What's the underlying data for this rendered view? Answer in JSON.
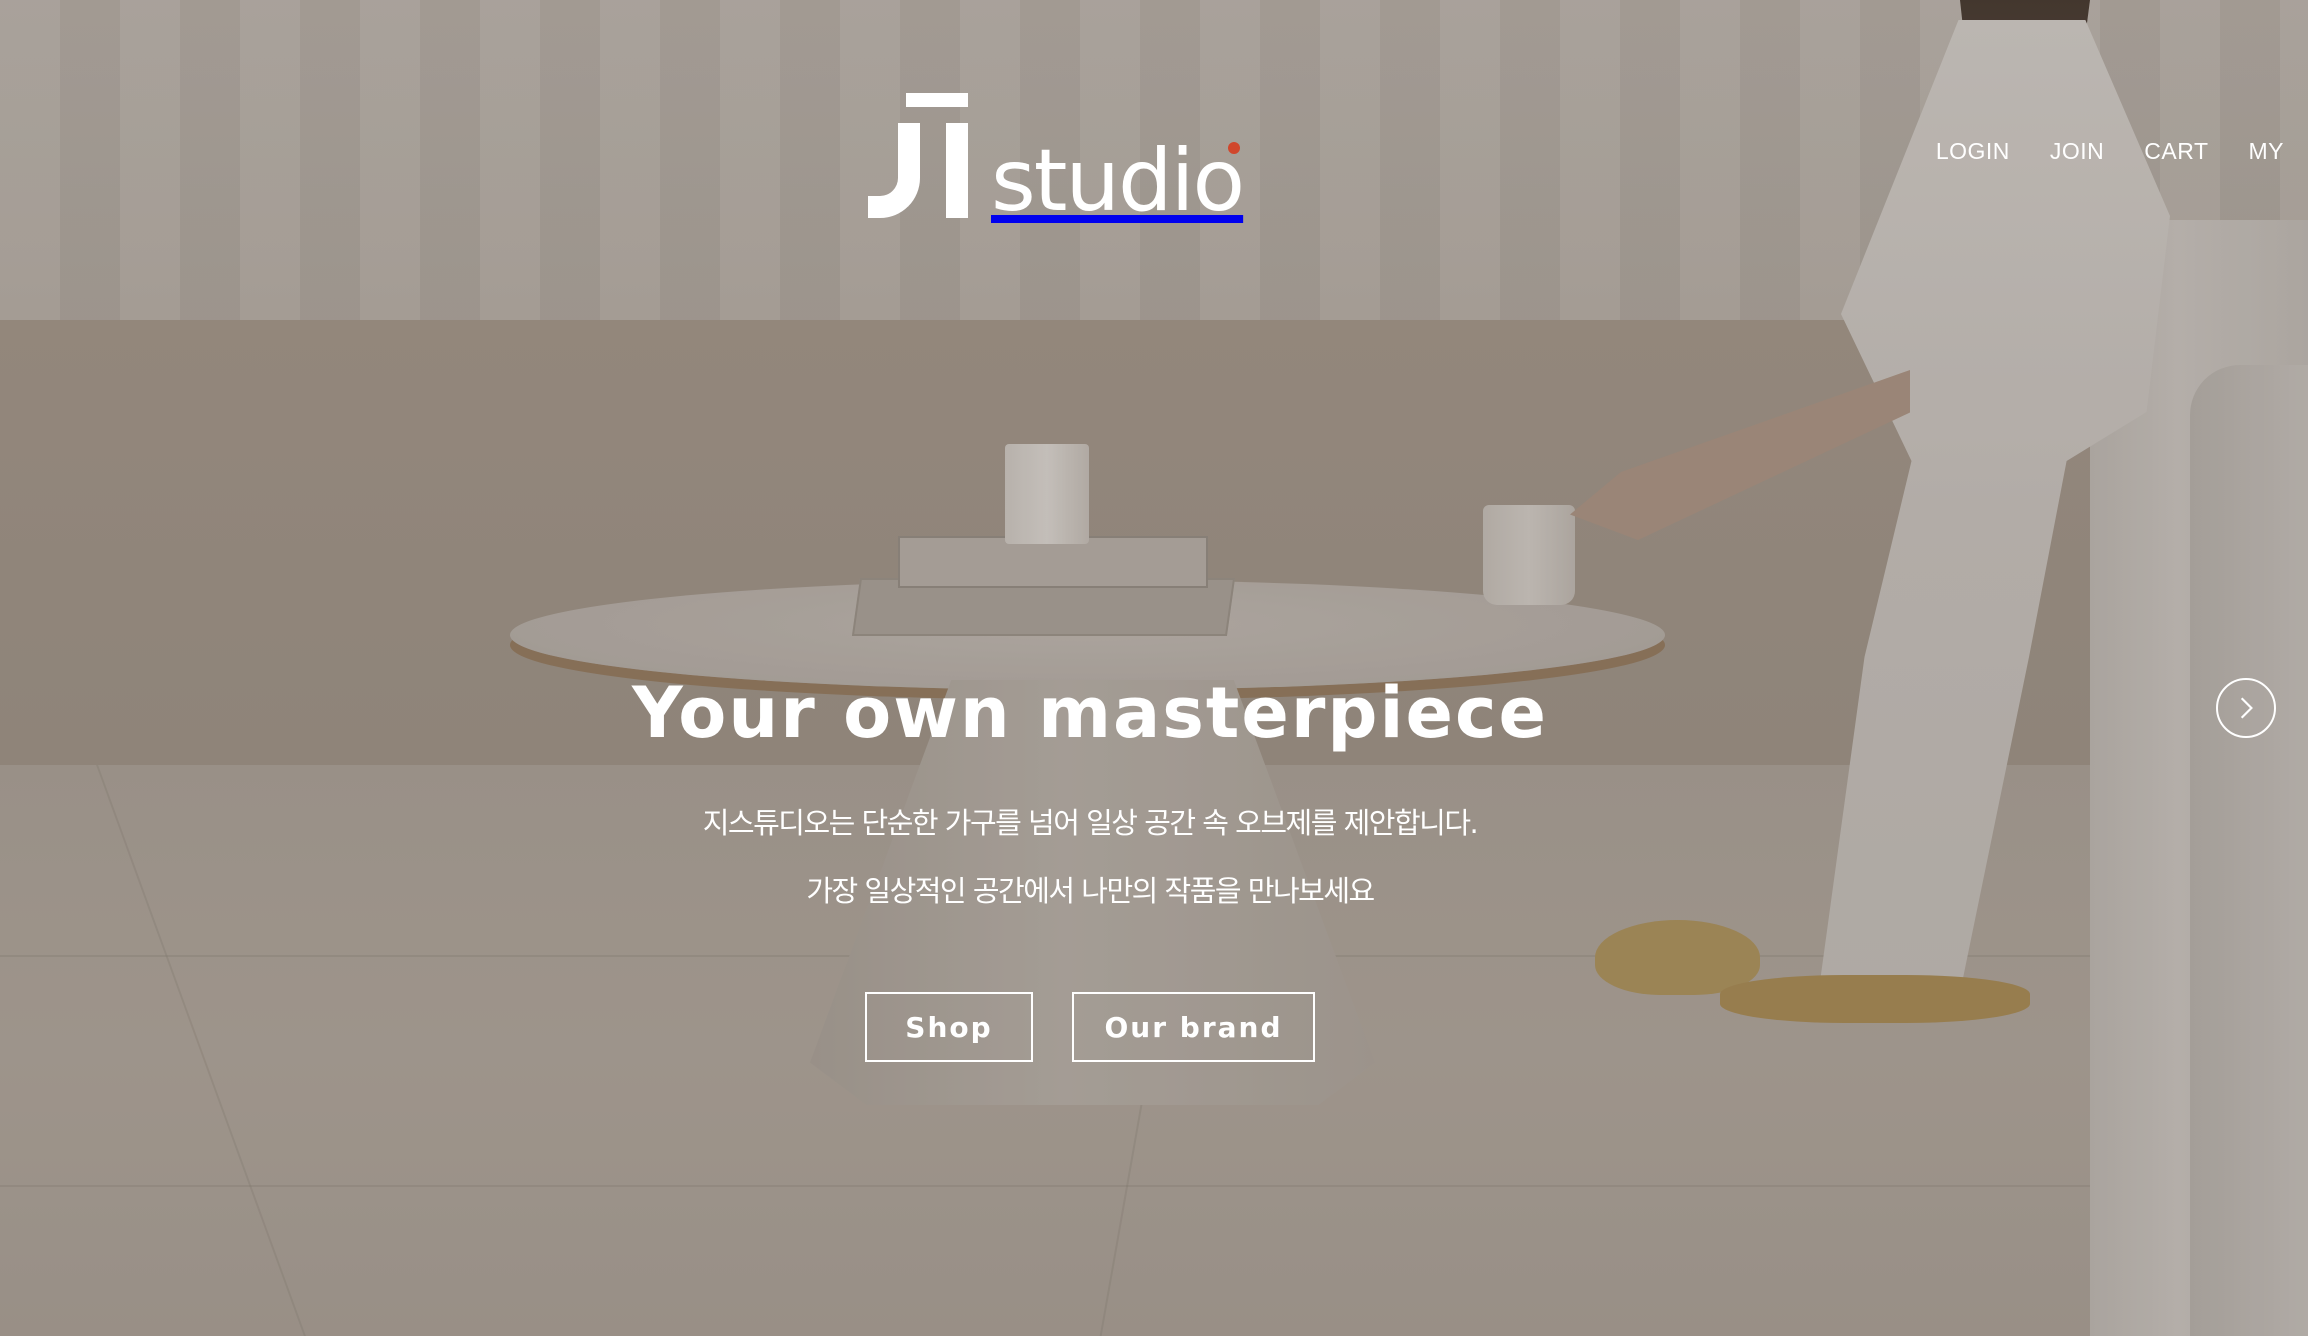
{
  "brand": {
    "logo_text": "studio",
    "logo_mark": "几",
    "accent_color": "#d0472c"
  },
  "nav": {
    "items": [
      {
        "label": "LOGIN"
      },
      {
        "label": "JOIN"
      },
      {
        "label": "CART"
      },
      {
        "label": "MY"
      }
    ]
  },
  "hero": {
    "headline": "Your own masterpiece",
    "subtitle_line1": "지스튜디오는 단순한 가구를 넘어 일상 공간 속 오브제를 제안합니다.",
    "subtitle_line2": "가장 일상적인 공간에서 나만의 작품을 만나보세요",
    "buttons": {
      "shop": "Shop",
      "brand": "Our brand"
    },
    "next_icon": "chevron-right-icon"
  }
}
